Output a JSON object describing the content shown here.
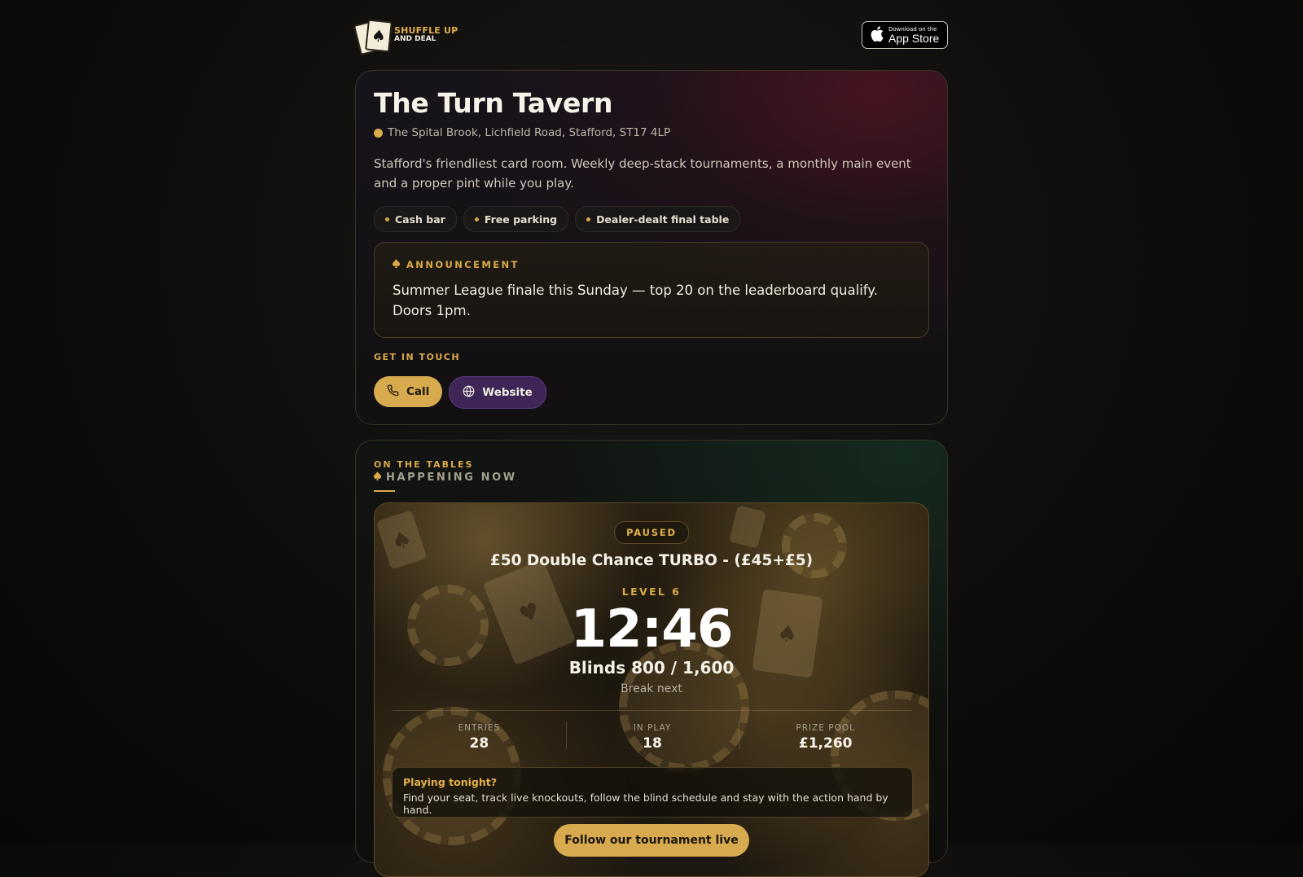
{
  "header": {
    "logo_line1": "SHUFFLE UP",
    "logo_line2": "AND DEAL",
    "appstore_small": "Download on the",
    "appstore_big": "App Store"
  },
  "venue": {
    "name": "The Turn Tavern",
    "address": "The Spital Brook, Lichfield Road, Stafford, ST17 4LP",
    "description": "Stafford's friendliest card room. Weekly deep-stack tournaments, a monthly main event and a proper pint while you play.",
    "tags": [
      "Cash bar",
      "Free parking",
      "Dealer-dealt final table"
    ],
    "announcement_label": "ANNOUNCEMENT",
    "announcement_text": "Summer League finale this Sunday — top 20 on the leaderboard qualify. Doors 1pm.",
    "contact_heading": "GET IN TOUCH",
    "call_label": "Call",
    "website_label": "Website"
  },
  "tables": {
    "eyebrow": "ON THE TABLES",
    "heading": "HAPPENING NOW",
    "status": "PAUSED",
    "tournament": "£50 Double Chance TURBO - (£45+£5)",
    "level": "LEVEL 6",
    "clock": "12:46",
    "blinds": "Blinds 800 / 1,600",
    "next": "Break next",
    "stats": [
      {
        "label": "ENTRIES",
        "value": "28"
      },
      {
        "label": "IN PLAY",
        "value": "18"
      },
      {
        "label": "PRIZE POOL",
        "value": "£1,260"
      }
    ],
    "tonight_title": "Playing tonight?",
    "tonight_text": "Find your seat, track live knockouts, follow the blind schedule and stay with the action hand by hand.",
    "cta_label": "Follow our tournament live"
  },
  "colors": {
    "accent_gold": "#d9a94a",
    "button_gold": "#d7aa4f",
    "website_purple": "#3d2557"
  },
  "icons": {
    "address": "location-dot-icon",
    "announcement": "spade-icon",
    "call": "phone-icon",
    "website": "globe-icon",
    "apple": "apple-icon"
  }
}
